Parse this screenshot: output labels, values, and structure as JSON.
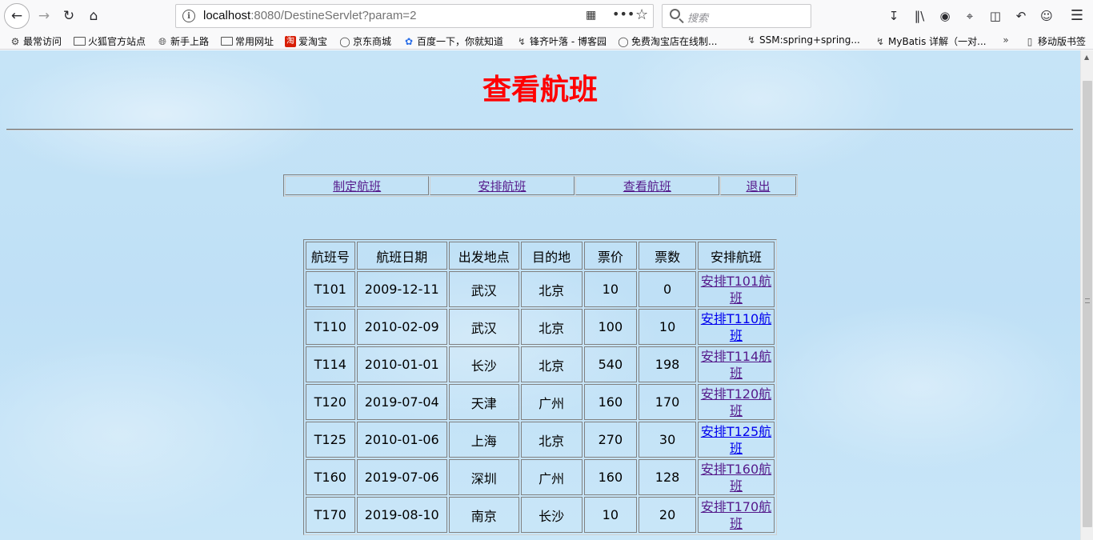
{
  "browser": {
    "url_host": "localhost",
    "url_rest": ":8080/DestineServlet?param=2",
    "search_placeholder": "搜索"
  },
  "bookmarks": [
    {
      "label": "最常访问",
      "icon": "gear-icon"
    },
    {
      "label": "火狐官方站点",
      "icon": "folder-icon"
    },
    {
      "label": "新手上路",
      "icon": "globe-icon"
    },
    {
      "label": "常用网址",
      "icon": "folder-icon"
    },
    {
      "label": "爱淘宝",
      "icon": "taobao-icon"
    },
    {
      "label": "京东商城",
      "icon": "globe-icon"
    },
    {
      "label": "百度一下，你就知道",
      "icon": "baidu-paw-icon"
    },
    {
      "label": "锋齐叶落 - 博客园",
      "icon": "blog-icon"
    },
    {
      "label": "免费淘宝店在线制...",
      "icon": "globe-icon"
    },
    {
      "label": "SSM:spring+spring...",
      "icon": "blog-icon"
    },
    {
      "label": "MyBatis 详解（一对...",
      "icon": "blog-icon"
    },
    {
      "label": "移动版书签",
      "icon": "mobile-icon"
    }
  ],
  "page": {
    "title": "查看航班",
    "menu": [
      "制定航班",
      "安排航班",
      "查看航班",
      "退出"
    ],
    "table": {
      "headers": [
        "航班号",
        "航班日期",
        "出发地点",
        "目的地",
        "票价",
        "票数",
        "安排航班"
      ],
      "rows": [
        {
          "id": "T101",
          "date": "2009-12-11",
          "from": "武汉",
          "to": "北京",
          "price": "10",
          "tickets": "0",
          "link1": "安排T101航",
          "link2": "班",
          "visited": true
        },
        {
          "id": "T110",
          "date": "2010-02-09",
          "from": "武汉",
          "to": "北京",
          "price": "100",
          "tickets": "10",
          "link1": "安排T110航",
          "link2": "班",
          "visited": false
        },
        {
          "id": "T114",
          "date": "2010-01-01",
          "from": "长沙",
          "to": "北京",
          "price": "540",
          "tickets": "198",
          "link1": "安排T114航",
          "link2": "班",
          "visited": true
        },
        {
          "id": "T120",
          "date": "2019-07-04",
          "from": "天津",
          "to": "广州",
          "price": "160",
          "tickets": "170",
          "link1": "安排T120航",
          "link2": "班",
          "visited": true
        },
        {
          "id": "T125",
          "date": "2010-01-06",
          "from": "上海",
          "to": "北京",
          "price": "270",
          "tickets": "30",
          "link1": "安排T125航",
          "link2": "班",
          "visited": false
        },
        {
          "id": "T160",
          "date": "2019-07-06",
          "from": "深圳",
          "to": "广州",
          "price": "160",
          "tickets": "128",
          "link1": "安排T160航",
          "link2": "班",
          "visited": true
        },
        {
          "id": "T170",
          "date": "2019-08-10",
          "from": "南京",
          "to": "长沙",
          "price": "10",
          "tickets": "20",
          "link1": "安排T170航",
          "link2": "班",
          "visited": true
        }
      ]
    }
  },
  "colors": {
    "title_red": "#ff0000",
    "visited_link": "#551a8b",
    "link": "#0000ee",
    "page_bg": "#c6e4f7"
  }
}
